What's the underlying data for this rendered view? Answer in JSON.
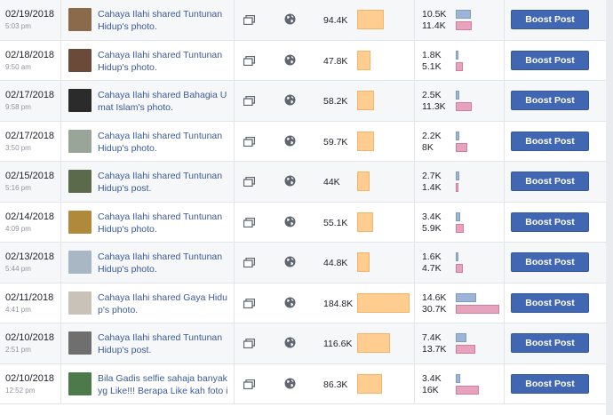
{
  "table": {
    "rows": [
      {
        "date": "02/19/2018",
        "time": "5:03 pm",
        "post": "Cahaya Ilahi shared Tuntunan Hidup's photo.",
        "reach": "94.4K",
        "reach_value": 94400,
        "eng_top": "10.5K",
        "eng_top_value": 10500,
        "eng_bottom": "11.4K",
        "eng_bottom_value": 11400,
        "thumb_color": "#8a6a4a",
        "boost_label": "Boost Post"
      },
      {
        "date": "02/18/2018",
        "time": "9:50 am",
        "post": "Cahaya Ilahi shared Tuntunan Hidup's photo.",
        "reach": "47.8K",
        "reach_value": 47800,
        "eng_top": "1.8K",
        "eng_top_value": 1800,
        "eng_bottom": "5.1K",
        "eng_bottom_value": 5100,
        "thumb_color": "#6b4a3a",
        "boost_label": "Boost Post"
      },
      {
        "date": "02/17/2018",
        "time": "9:58 pm",
        "post": "Cahaya Ilahi shared Bahagia Umat Islam's photo.",
        "reach": "58.2K",
        "reach_value": 58200,
        "eng_top": "2.5K",
        "eng_top_value": 2500,
        "eng_bottom": "11.3K",
        "eng_bottom_value": 11300,
        "thumb_color": "#2b2b2b",
        "boost_label": "Boost Post"
      },
      {
        "date": "02/17/2018",
        "time": "3:50 pm",
        "post": "Cahaya Ilahi shared Tuntunan Hidup's photo.",
        "reach": "59.7K",
        "reach_value": 59700,
        "eng_top": "2.2K",
        "eng_top_value": 2200,
        "eng_bottom": "8K",
        "eng_bottom_value": 8000,
        "thumb_color": "#9aa59a",
        "boost_label": "Boost Post"
      },
      {
        "date": "02/15/2018",
        "time": "5:16 pm",
        "post": "Cahaya Ilahi shared Tuntunan Hidup's post.",
        "reach": "44K",
        "reach_value": 44000,
        "eng_top": "2.7K",
        "eng_top_value": 2700,
        "eng_bottom": "1.4K",
        "eng_bottom_value": 1400,
        "thumb_color": "#5a6a4a",
        "boost_label": "Boost Post"
      },
      {
        "date": "02/14/2018",
        "time": "4:09 pm",
        "post": "Cahaya Ilahi shared Tuntunan Hidup's photo.",
        "reach": "55.1K",
        "reach_value": 55100,
        "eng_top": "3.4K",
        "eng_top_value": 3400,
        "eng_bottom": "5.9K",
        "eng_bottom_value": 5900,
        "thumb_color": "#b08a3a",
        "boost_label": "Boost Post"
      },
      {
        "date": "02/13/2018",
        "time": "5:44 pm",
        "post": "Cahaya Ilahi shared Tuntunan Hidup's photo.",
        "reach": "44.8K",
        "reach_value": 44800,
        "eng_top": "1.6K",
        "eng_top_value": 1600,
        "eng_bottom": "4.7K",
        "eng_bottom_value": 4700,
        "thumb_color": "#a9b6c4",
        "boost_label": "Boost Post"
      },
      {
        "date": "02/11/2018",
        "time": "4:41 pm",
        "post": "Cahaya Ilahi shared Gaya Hidup's photo.",
        "reach": "184.8K",
        "reach_value": 184800,
        "eng_top": "14.6K",
        "eng_top_value": 14600,
        "eng_bottom": "30.7K",
        "eng_bottom_value": 30700,
        "thumb_color": "#c9c2b8",
        "boost_label": "Boost Post"
      },
      {
        "date": "02/10/2018",
        "time": "2:51 pm",
        "post": "Cahaya Ilahi shared Tuntunan Hidup's post.",
        "reach": "116.6K",
        "reach_value": 116600,
        "eng_top": "7.4K",
        "eng_top_value": 7400,
        "eng_bottom": "13.7K",
        "eng_bottom_value": 13700,
        "thumb_color": "#6f6f6f",
        "boost_label": "Boost Post"
      },
      {
        "date": "02/10/2018",
        "time": "12:52 pm",
        "post": "Bila Gadis selfie sahaja banyak yg Like!!! Berapa Like kah foto ind",
        "reach": "86.3K",
        "reach_value": 86300,
        "eng_top": "3.4K",
        "eng_top_value": 3400,
        "eng_bottom": "16K",
        "eng_bottom_value": 16000,
        "thumb_color": "#4d7a4a",
        "boost_label": "Boost Post"
      }
    ]
  },
  "icons": {
    "post_type": "multi-photo-icon",
    "audience": "globe-icon"
  },
  "colors": {
    "reach_bar": "#ffcd8f",
    "engagement_top_bar": "#9cb4d8",
    "engagement_bottom_bar": "#e8a3bc",
    "boost_button": "#4267b2",
    "post_link": "#3b5998"
  }
}
